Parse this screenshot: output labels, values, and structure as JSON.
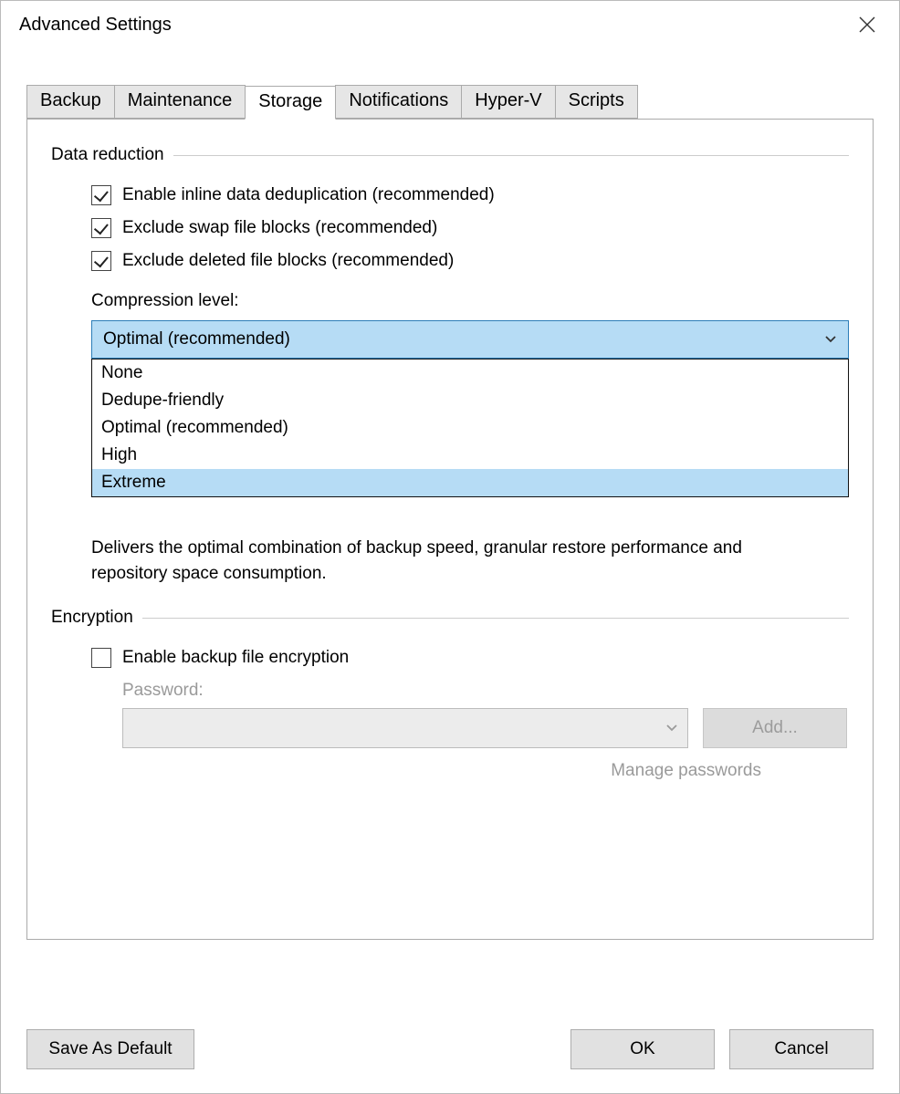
{
  "window": {
    "title": "Advanced Settings"
  },
  "tabs": [
    {
      "label": "Backup"
    },
    {
      "label": "Maintenance"
    },
    {
      "label": "Storage",
      "active": true
    },
    {
      "label": "Notifications"
    },
    {
      "label": "Hyper-V"
    },
    {
      "label": "Scripts"
    }
  ],
  "data_reduction": {
    "header": "Data reduction",
    "dedup_label": "Enable inline data deduplication (recommended)",
    "swap_label": "Exclude swap file blocks (recommended)",
    "deleted_label": "Exclude deleted file blocks (recommended)",
    "compression_label": "Compression level:",
    "compression_selected": "Optimal (recommended)",
    "compression_options": {
      "o0": "None",
      "o1": "Dedupe-friendly",
      "o2": "Optimal (recommended)",
      "o3": "High",
      "o4": "Extreme"
    },
    "description": "Delivers the optimal combination of backup speed, granular restore performance and repository space consumption."
  },
  "encryption": {
    "header": "Encryption",
    "enable_label": "Enable backup file encryption",
    "password_label": "Password:",
    "add_button": "Add...",
    "manage_link": "Manage passwords"
  },
  "buttons": {
    "save_default": "Save As Default",
    "ok": "OK",
    "cancel": "Cancel"
  }
}
